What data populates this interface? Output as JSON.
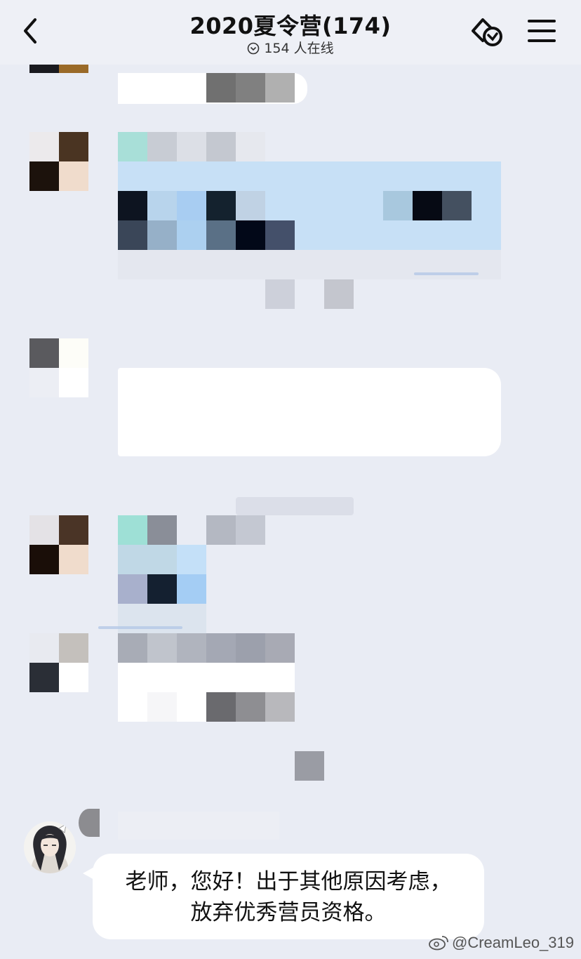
{
  "header": {
    "title": "2020夏令营(174)",
    "online_count": "154 人在线",
    "icons": [
      "back-arrow-icon",
      "online-status-icon",
      "share-icon",
      "menu-icon"
    ]
  },
  "messages": [
    {
      "sender": "redacted",
      "content": "pixelated (redacted)"
    },
    {
      "sender": "redacted",
      "content": "pixelated (redacted)"
    },
    {
      "sender": "redacted",
      "content": "pixelated (redacted)"
    },
    {
      "sender": "redacted",
      "content": "pixelated (redacted)"
    },
    {
      "sender": "redacted",
      "content": "pixelated (redacted)"
    },
    {
      "sender": "anime-avatar-user",
      "lines": [
        "老师，您好！出于其他原因考虑，",
        "放弃优秀营员资格。"
      ]
    }
  ],
  "watermark": "@CreamLeo_319",
  "colors": {
    "background": "#e9ecf4",
    "bubble": "#ffffff",
    "bubble_blue": "#c7e0f6"
  }
}
